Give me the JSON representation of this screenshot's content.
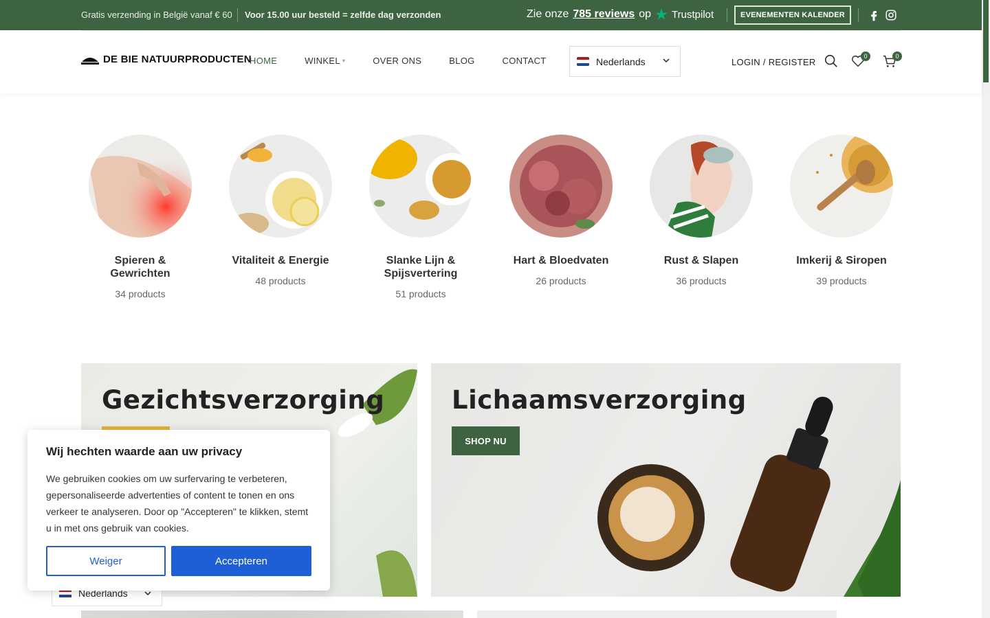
{
  "topbar": {
    "shipping": "Gratis verzending in België vanaf € 60",
    "same_day": "Voor 15.00 uur besteld = zelfde dag verzonden",
    "trustpilot_prefix": "Zie onze",
    "trustpilot_link": "785 reviews",
    "trustpilot_suffix": "op",
    "trustpilot_brand": "Trustpilot",
    "events_button": "EVENEMENTEN KALENDER"
  },
  "header": {
    "logo_text": "DE BIE NATUURPRODUCTEN",
    "nav": [
      {
        "label": "HOME",
        "active": true
      },
      {
        "label": "WINKEL",
        "has_caret": true
      },
      {
        "label": "OVER ONS"
      },
      {
        "label": "BLOG"
      },
      {
        "label": "CONTACT"
      }
    ],
    "language": "Nederlands",
    "login": "LOGIN / REGISTER",
    "wishlist_count": "0",
    "cart_count": "0"
  },
  "categories": [
    {
      "name": "Spieren & Gewrichten",
      "count": "34 products"
    },
    {
      "name": "Vitaliteit & Energie",
      "count": "48 products"
    },
    {
      "name": "Slanke Lijn & Spijsvertering",
      "count": "51 products"
    },
    {
      "name": "Hart & Bloedvaten",
      "count": "26 products"
    },
    {
      "name": "Rust & Slapen",
      "count": "36 products"
    },
    {
      "name": "Imkerij & Siropen",
      "count": "39 products"
    }
  ],
  "banners": {
    "face": {
      "title": "Gezichtsverzorging"
    },
    "body": {
      "title": "Lichaamsverzorging",
      "button": "SHOP NU"
    }
  },
  "cookie": {
    "title": "Wij hechten waarde aan uw privacy",
    "text": "We gebruiken cookies om uw surfervaring te verbeteren, gepersonaliseerde advertenties of content te tonen en ons verkeer te analyseren. Door op \"Accepteren\" te klikken, stemt u in met ons gebruik van cookies.",
    "reject": "Weiger",
    "accept": "Accepteren"
  },
  "floating_language": "Nederlands",
  "colors": {
    "brand_green": "#3d6340",
    "accent_yellow": "#e8b23a",
    "cookie_blue": "#1f5fd6"
  }
}
